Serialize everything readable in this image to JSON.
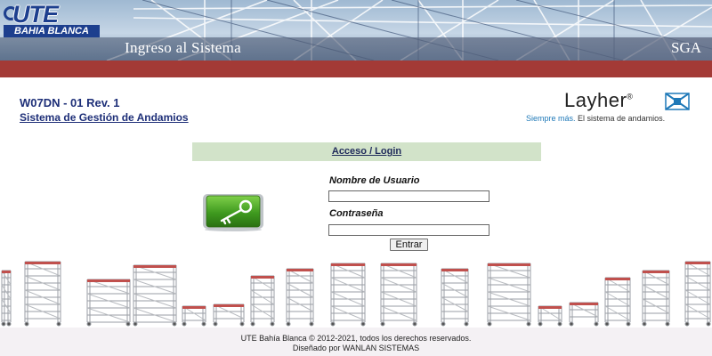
{
  "header": {
    "logo_main": "UTE",
    "logo_sub": "BAHIA BLANCA",
    "title": "Ingreso al Sistema",
    "app_code": "SGA"
  },
  "document": {
    "code": "W07DN - 01 Rev. 1",
    "system_name": "Sistema de Gestión de Andamios"
  },
  "brand": {
    "name": "Layher",
    "symbol": "®",
    "slogan_blue": "Siempre más.",
    "slogan_rest": " El sistema de andamios."
  },
  "login": {
    "header_label": "Acceso / Login",
    "username_label": "Nombre de Usuario",
    "username_value": "",
    "password_label": "Contraseña",
    "password_value": "",
    "submit_label": "Entrar",
    "icon": "key-icon"
  },
  "footer": {
    "copyright": "UTE Bahía Blanca © 2012-2021, todos los derechos reservados.",
    "designer": "Diseñado por WANLAN SISTEMAS"
  },
  "colors": {
    "accent_blue": "#1e2f78",
    "header_red": "#a33a36",
    "login_header_bg": "#d2e3c9",
    "key_green": "#3f9a1f",
    "slogan_blue": "#1f79b8"
  }
}
